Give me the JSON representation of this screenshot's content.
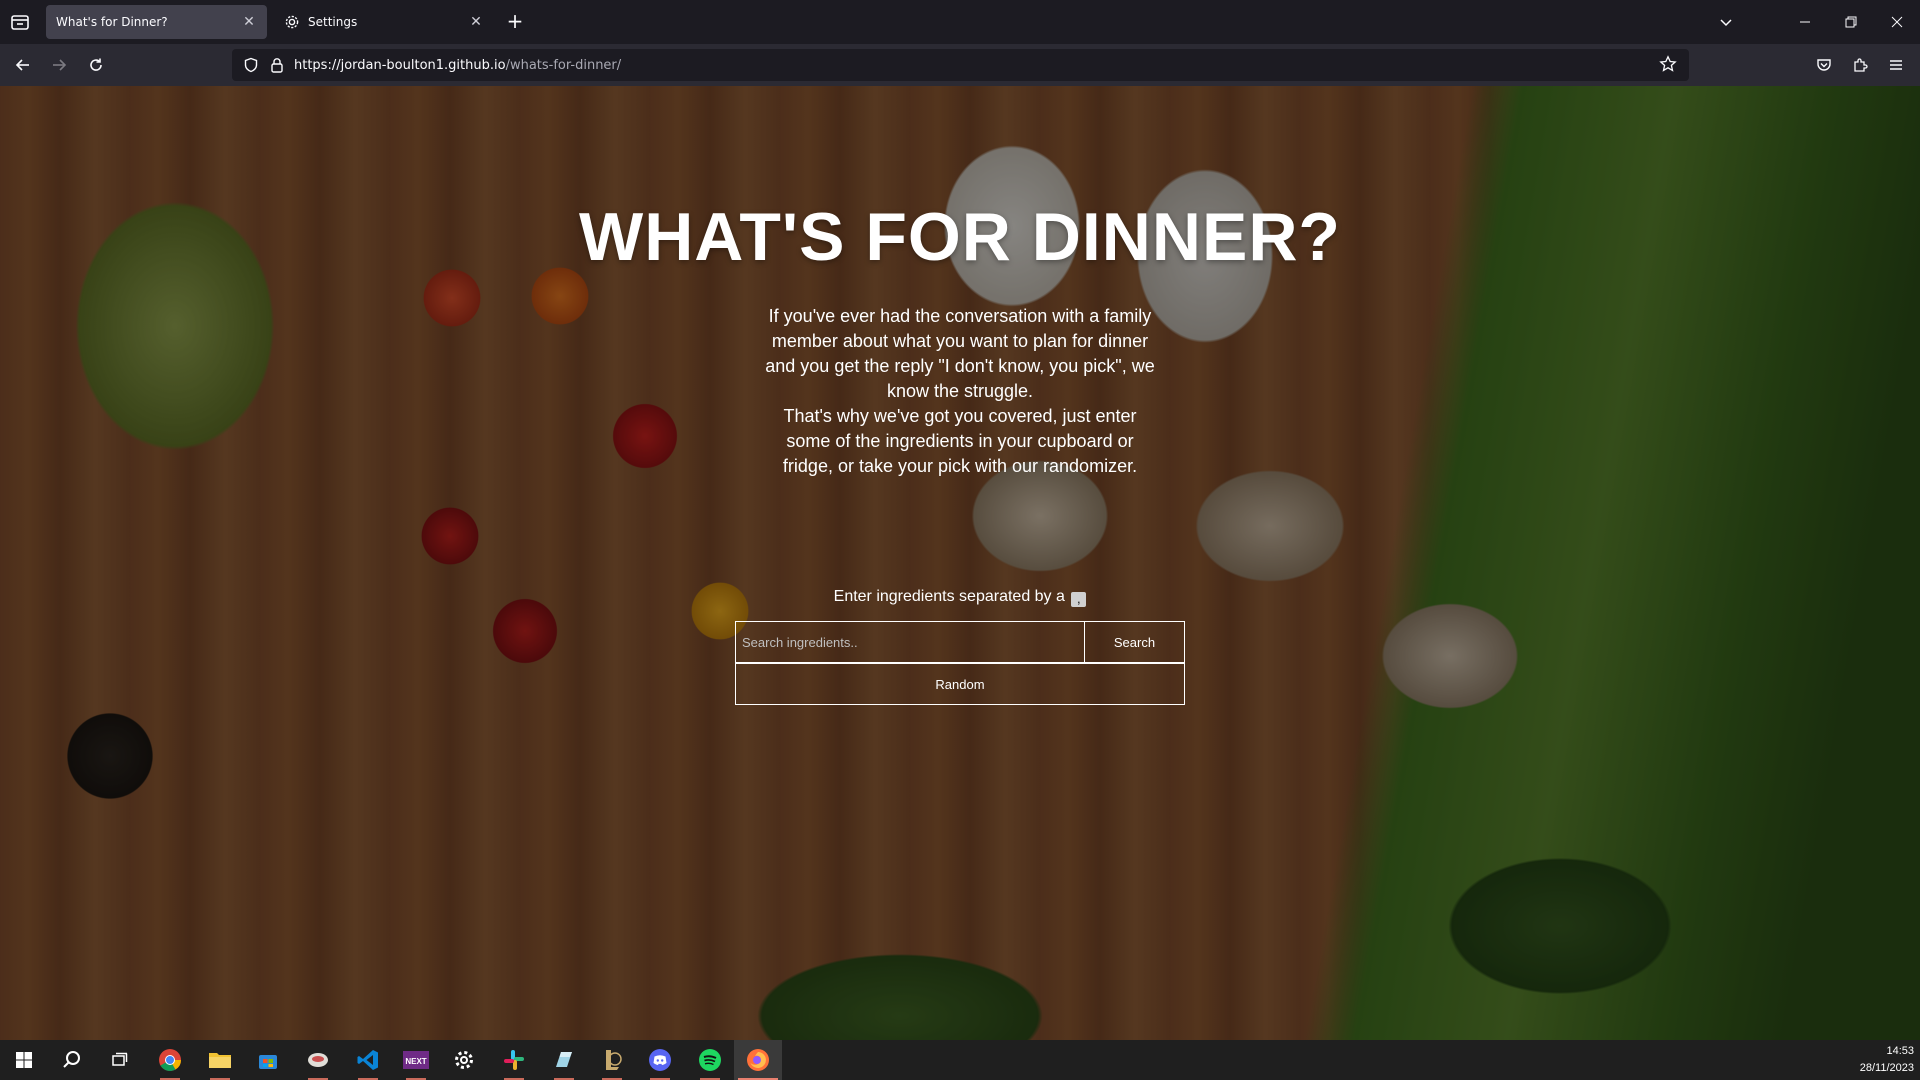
{
  "browser": {
    "tabs": [
      {
        "label": "What's for Dinner?",
        "active": true
      },
      {
        "label": "Settings",
        "active": false,
        "icon": "gear-icon"
      }
    ],
    "url_host": "https://jordan-boulton1.github.io",
    "url_path": "/whats-for-dinner/"
  },
  "page": {
    "title": "WHAT'S FOR DINNER?",
    "description_1": "If you've ever had the conversation with a family member about what you want to plan for dinner and you get the reply \"I don't know, you pick\", we know the struggle.",
    "description_2": "That's why we've got you covered, just enter some of the ingredients in your cupboard or fridge, or take your pick with our randomizer.",
    "ingredients_label": "Enter ingredients separated by a",
    "separator_key": ",",
    "search_placeholder": "Search ingredients..",
    "search_value": "",
    "search_button": "Search",
    "random_button": "Random"
  },
  "taskbar": {
    "apps": [
      "start-icon",
      "search-icon",
      "task-view-icon",
      "chrome-icon",
      "file-explorer-icon",
      "store-icon",
      "app-icon",
      "vscode-icon",
      "next-icon",
      "settings-icon",
      "slack-icon",
      "app-icon-2",
      "league-icon",
      "discord-icon",
      "spotify-icon",
      "firefox-icon"
    ],
    "time": "14:53",
    "date": "28/11/2023"
  },
  "colors": {
    "accent_tab": "#42414d",
    "toolbar": "#2b2a33",
    "taskbar": "#1f1f1f",
    "running_indicator": "#c96a5b"
  }
}
